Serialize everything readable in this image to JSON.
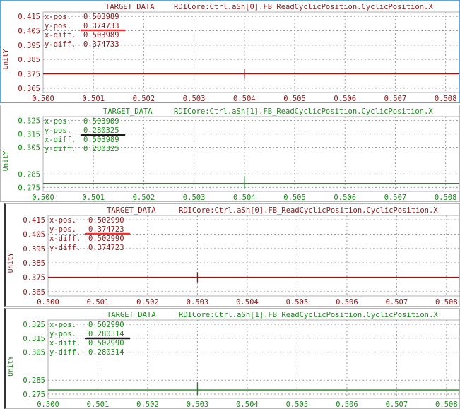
{
  "panels": [
    {
      "header_tag": "TARGET_DATA",
      "header_var": "RDICore:Ctrl.aSh[0].FB_ReadCyclicPosition.CyclicPosition.X",
      "y_axis_label": "UnitY",
      "readout": {
        "xpos_label": "x-pos.",
        "xpos_value": "0.503989",
        "ypos_label": "y-pos.",
        "ypos_value": "0.374733",
        "xdiff_label": "x-diff.",
        "xdiff_value": "0.503989",
        "ydiff_label": "y-diff.",
        "ydiff_value": "0.374733"
      },
      "underline_color": "#ff2a2a",
      "color": "#8b1a1a"
    },
    {
      "header_tag": "TARGET_DATA",
      "header_var": "RDICore:Ctrl.aSh[1].FB_ReadCyclicPosition.CyclicPosition.X",
      "y_axis_label": "UnitY",
      "readout": {
        "xpos_label": "x-pos.",
        "xpos_value": "0.503989",
        "ypos_label": "y-pos.",
        "ypos_value": "0.280325",
        "xdiff_label": "x-diff.",
        "xdiff_value": "0.503989",
        "ydiff_label": "y-diff.",
        "ydiff_value": "0.280325"
      },
      "underline_color": "#1a1a1a",
      "color": "#1a8a1a"
    },
    {
      "header_tag": "TARGET_DATA",
      "header_var": "RDICore:Ctrl.aSh[0].FB_ReadCyclicPosition.CyclicPosition.X",
      "y_axis_label": "UnitY",
      "readout": {
        "xpos_label": "x-pos.",
        "xpos_value": "0.502990",
        "ypos_label": "y-pos.",
        "ypos_value": "0.374723",
        "xdiff_label": "x-diff.",
        "xdiff_value": "0.502990",
        "ydiff_label": "y-diff.",
        "ydiff_value": "0.374723"
      },
      "underline_color": "#ff2a2a",
      "color": "#8b1a1a"
    },
    {
      "header_tag": "TARGET_DATA",
      "header_var": "RDICore:Ctrl.aSh[1].FB_ReadCyclicPosition.CyclicPosition.X",
      "y_axis_label": "UnitY",
      "readout": {
        "xpos_label": "x-pos.",
        "xpos_value": "0.502990",
        "ypos_label": "y-pos.",
        "ypos_value": "0.280314",
        "xdiff_label": "x-diff.",
        "xdiff_value": "0.502990",
        "ydiff_label": "y-diff.",
        "ydiff_value": "0.280314"
      },
      "underline_color": "#1a1a1a",
      "color": "#1a8a1a"
    }
  ],
  "chart_data": [
    {
      "type": "line",
      "x_ticks": [
        "0.500",
        "0.501",
        "0.502",
        "0.503",
        "0.504",
        "0.505",
        "0.506",
        "0.507",
        "0.508"
      ],
      "y_ticks": [
        "0.415",
        "0.405",
        "0.395",
        "0.385",
        "0.375",
        "0.365"
      ],
      "xlim": [
        0.5,
        0.5083
      ],
      "ylim": [
        0.362,
        0.418
      ],
      "grid": true,
      "series": [
        {
          "baseline": 0.375,
          "spike_x": 0.504,
          "spike_low": 0.3715,
          "spike_high": 0.3785
        }
      ]
    },
    {
      "type": "line",
      "x_ticks": [
        "0.500",
        "0.501",
        "0.502",
        "0.503",
        "0.504",
        "0.505",
        "0.506",
        "0.507",
        "0.508"
      ],
      "y_ticks": [
        "0.325",
        "0.315",
        "0.305",
        "0.285",
        "0.275"
      ],
      "xlim": [
        0.5,
        0.5083
      ],
      "ylim": [
        0.272,
        0.328
      ],
      "grid": true,
      "series": [
        {
          "baseline": 0.278,
          "spike_x": 0.504,
          "spike_low": 0.2745,
          "spike_high": 0.2835
        }
      ]
    },
    {
      "type": "line",
      "x_ticks": [
        "0.500",
        "0.501",
        "0.502",
        "0.503",
        "0.504",
        "0.505",
        "0.506",
        "0.507",
        "0.508"
      ],
      "y_ticks": [
        "0.415",
        "0.405",
        "0.395",
        "0.385",
        "0.375",
        "0.365"
      ],
      "xlim": [
        0.5,
        0.5083
      ],
      "ylim": [
        0.362,
        0.418
      ],
      "grid": true,
      "series": [
        {
          "baseline": 0.375,
          "spike_x": 0.503,
          "spike_low": 0.3715,
          "spike_high": 0.3785
        }
      ]
    },
    {
      "type": "line",
      "x_ticks": [
        "0.500",
        "0.501",
        "0.502",
        "0.503",
        "0.504",
        "0.505",
        "0.506",
        "0.507",
        "0.508"
      ],
      "y_ticks": [
        "0.325",
        "0.315",
        "0.305",
        "0.285",
        "0.275"
      ],
      "xlim": [
        0.5,
        0.5083
      ],
      "ylim": [
        0.272,
        0.328
      ],
      "grid": true,
      "series": [
        {
          "baseline": 0.278,
          "spike_x": 0.503,
          "spike_low": 0.2745,
          "spike_high": 0.2835
        }
      ]
    }
  ]
}
